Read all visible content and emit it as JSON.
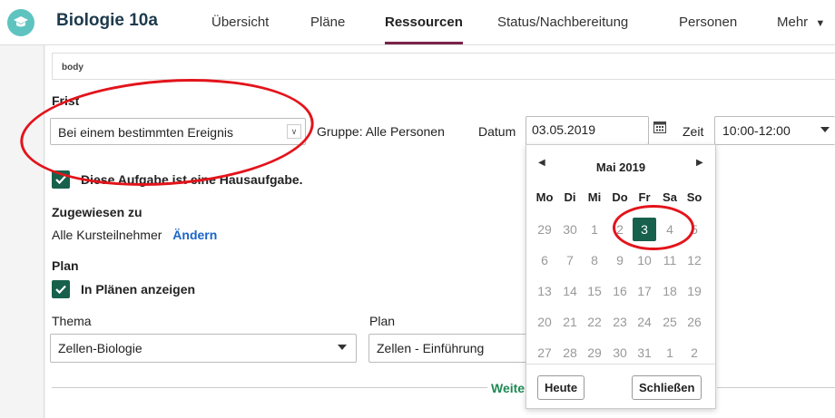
{
  "header": {
    "course_title": "Biologie 10a",
    "tabs": [
      {
        "label": "Übersicht"
      },
      {
        "label": "Pläne"
      },
      {
        "label": "Ressourcen",
        "active": true
      },
      {
        "label": "Status/Nachbereitung"
      },
      {
        "label": "Personen"
      },
      {
        "label": "Mehr"
      }
    ]
  },
  "editor": {
    "body_label": "body"
  },
  "deadline": {
    "heading": "Frist",
    "type_value": "Bei einem bestimmten Ereignis",
    "group_text": "Gruppe: Alle Personen",
    "date_label": "Datum",
    "date_value": "03.05.2019",
    "time_label": "Zeit",
    "time_value": "10:00-12:00"
  },
  "homework": {
    "label": "Diese Aufgabe ist eine Hausaufgabe.",
    "checked": true
  },
  "assigned": {
    "heading": "Zugewiesen zu",
    "value": "Alle Kursteilnehmer",
    "change_link": "Ändern"
  },
  "plan": {
    "heading": "Plan",
    "show_label": "In Plänen anzeigen",
    "checked": true,
    "topic_label": "Thema",
    "topic_value": "Zellen-Biologie",
    "plan_label": "Plan",
    "plan_value": "Zellen - Einführung"
  },
  "more_text": "Weite",
  "datepicker": {
    "month": "Mai 2019",
    "prev_icon": "triangle-left",
    "next_icon": "triangle-right",
    "weekdays": [
      "Mo",
      "Di",
      "Mi",
      "Do",
      "Fr",
      "Sa",
      "So"
    ],
    "weeks": [
      [
        "29",
        "30",
        "1",
        "2",
        "3",
        "4",
        "5"
      ],
      [
        "6",
        "7",
        "8",
        "9",
        "10",
        "11",
        "12"
      ],
      [
        "13",
        "14",
        "15",
        "16",
        "17",
        "18",
        "19"
      ],
      [
        "20",
        "21",
        "22",
        "23",
        "24",
        "25",
        "26"
      ],
      [
        "27",
        "28",
        "29",
        "30",
        "31",
        "1",
        "2"
      ]
    ],
    "selected": "3",
    "today_button": "Heute",
    "close_button": "Schließen"
  },
  "colors": {
    "accent": "#17604c",
    "nav_active": "#7a2449",
    "link": "#1a65c8",
    "annotation": "#e3141b"
  }
}
